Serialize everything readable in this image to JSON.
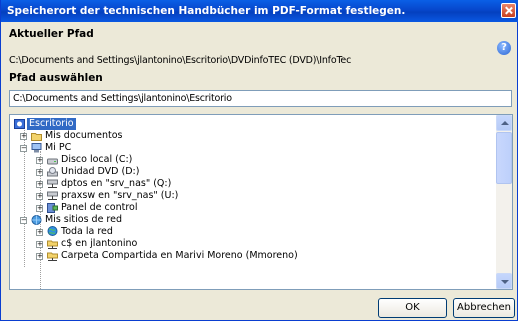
{
  "window": {
    "title": "Speicherort der technischen Handbücher im PDF-Format festlegen."
  },
  "current_path": {
    "label": "Aktueller Pfad",
    "value": "C:\\Documents and Settings\\jlantonino\\Escritorio\\DVDinfoTEC (DVD)\\InfoTec"
  },
  "select_path": {
    "label": "Pfad auswählen",
    "value": "C:\\Documents and Settings\\jlantonino\\Escritorio"
  },
  "tree": {
    "items": [
      {
        "label": "Escritorio",
        "icon": "desktop-icon",
        "selected": true
      },
      {
        "label": "Mis documentos",
        "icon": "folder-icon"
      },
      {
        "label": "Mi PC",
        "icon": "computer-icon"
      },
      {
        "label": "Disco local (C:)",
        "icon": "hard-drive-icon"
      },
      {
        "label": "Unidad DVD (D:)",
        "icon": "dvd-drive-icon"
      },
      {
        "label": "dptos en \"srv_nas\" (Q:)",
        "icon": "network-drive-icon"
      },
      {
        "label": "praxsw en \"srv_nas\" (U:)",
        "icon": "network-drive-icon"
      },
      {
        "label": "Panel de control",
        "icon": "control-panel-icon"
      },
      {
        "label": "Mis sitios de red",
        "icon": "network-places-icon"
      },
      {
        "label": "Toda la red",
        "icon": "globe-icon"
      },
      {
        "label": "c$ en jlantonino",
        "icon": "network-share-icon"
      },
      {
        "label": "Carpeta Compartida en Marivi Moreno (Mmoreno)",
        "icon": "network-share-icon"
      }
    ]
  },
  "buttons": {
    "ok": "OK",
    "cancel": "Abbrechen"
  },
  "colors": {
    "titlebar": "#0a58e2",
    "selection": "#316ac5",
    "dialog_bg": "#ece9d8"
  }
}
